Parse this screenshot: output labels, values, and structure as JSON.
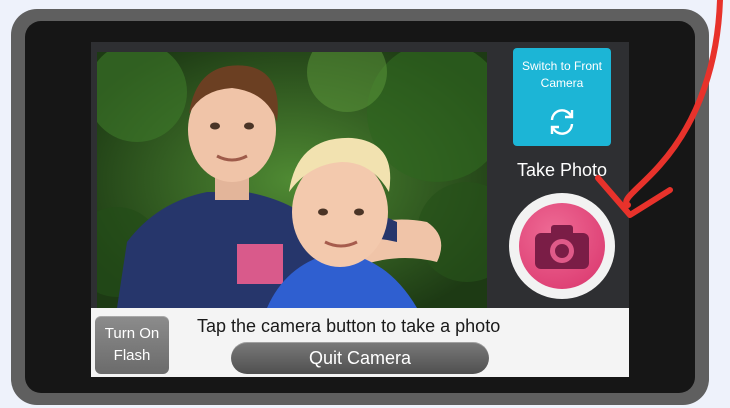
{
  "camera": {
    "switch_button_label": "Switch to Front Camera",
    "take_photo_label": "Take Photo",
    "flash_button_label": "Turn On Flash",
    "instruction_text": "Tap the camera button to take a photo",
    "quit_button_label": "Quit Camera"
  },
  "colors": {
    "switch_button": "#1cb5d6",
    "shutter": "#d9336b",
    "annotation_arrow": "#e8322b"
  },
  "icons": [
    "refresh-icon",
    "camera-icon"
  ]
}
